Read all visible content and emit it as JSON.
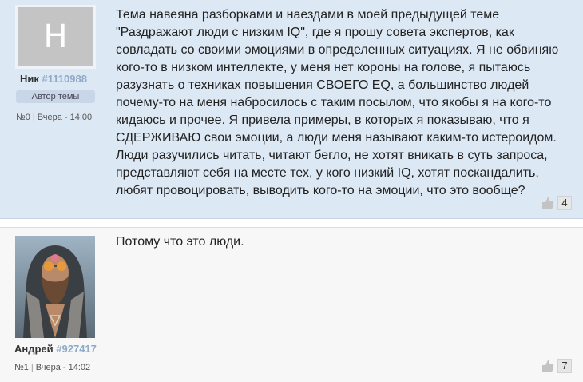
{
  "posts": [
    {
      "avatar_letter": "Н",
      "author_name": "Ник",
      "author_id": "#1110988",
      "badge": "Автор темы",
      "number": "№0",
      "date": "Вчера - 14:00",
      "text": "Тема навеяна разборками и наездами в моей предыдущей теме \"Раздражают люди с низким IQ\", где я прошу совета экспертов, как совладать со своими эмоциями в определенных ситуациях. Я не обвиняю кого-то в низком интеллекте, у меня нет короны на голове, я пытаюсь разузнать о техниках повышения СВОЕГО EQ, а большинство людей почему-то на меня набросилось с таким посылом, что якобы я на кого-то кидаюсь и прочее. Я привела примеры, в которых я показываю, что я СДЕРЖИВАЮ свои эмоции, а люди меня называют каким-то истероидом. Люди разучились читать, читают бегло, не хотят вникать в суть запроса, представляют себя на месте тех, у кого низкий IQ, хотят поскандалить, любят провоцировать, выводить кого-то на эмоции, что это вообще?",
      "likes": "4"
    },
    {
      "author_name": "Андрей",
      "author_id": "#927417",
      "number": "№1",
      "date": "Вчера - 14:02",
      "text": "Потому что это люди.",
      "likes": "7"
    }
  ],
  "icons": {
    "like": "thumbs-up-icon"
  },
  "colors": {
    "post_bg_topic": "#dde8f5",
    "user_id": "#8faac9",
    "badge_bg": "#c8d6e8"
  }
}
